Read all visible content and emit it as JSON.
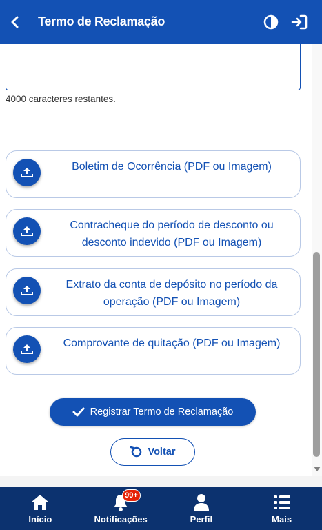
{
  "header": {
    "title": "Termo de Reclamação",
    "back_icon": "chevron-left-icon",
    "contrast_icon": "contrast-icon",
    "logout_icon": "sign-in-icon"
  },
  "form": {
    "char_counter": "4000 caracteres restantes."
  },
  "uploads": [
    {
      "label": "Boletim de Ocorrência  (PDF ou Imagem)",
      "icon": "upload-icon"
    },
    {
      "label": "Contracheque do período de desconto ou desconto indevido  (PDF ou Imagem)",
      "icon": "upload-icon"
    },
    {
      "label": "Extrato da conta de depósito no período da operação  (PDF ou Imagem)",
      "icon": "upload-icon"
    },
    {
      "label": "Comprovante de quitação  (PDF ou Imagem)",
      "icon": "upload-icon"
    }
  ],
  "actions": {
    "submit_label": "Registrar Termo de Reclamação",
    "back_label": "Voltar"
  },
  "nav": {
    "items": [
      {
        "label": "Início",
        "icon": "home-icon"
      },
      {
        "label": "Notificações",
        "icon": "bell-icon",
        "badge": "99+"
      },
      {
        "label": "Perfil",
        "icon": "user-icon"
      },
      {
        "label": "Mais",
        "icon": "list-icon"
      }
    ]
  },
  "colors": {
    "primary": "#1351b4",
    "nav_background": "#0c326f",
    "badge": "#e52207"
  }
}
